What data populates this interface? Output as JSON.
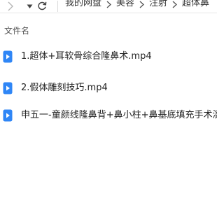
{
  "toolbar": {
    "forward_icon": "chevron-right-icon",
    "dropdown_icon": "caret-down-icon",
    "refresh_icon": "refresh-icon"
  },
  "breadcrumb": {
    "items": [
      "我的网盘",
      "美容",
      "注射",
      "超体鼻"
    ],
    "separator_icon": "chevron-right-icon"
  },
  "file_list": {
    "column_header": "文件名",
    "files": [
      {
        "name": "1.超体+耳软骨综合隆鼻术.mp4",
        "icon": "video-file-icon"
      },
      {
        "name": "2.假体雕刻技巧.mp4",
        "icon": "video-file-icon"
      },
      {
        "name": "申五一-童颜线隆鼻背+鼻小柱+鼻基底填充手术演示",
        "icon": "video-file-icon"
      }
    ]
  },
  "colors": {
    "accent": "#2f86f6",
    "text": "#222222",
    "muted": "#555555",
    "icon_gray": "#7a7a7a"
  }
}
